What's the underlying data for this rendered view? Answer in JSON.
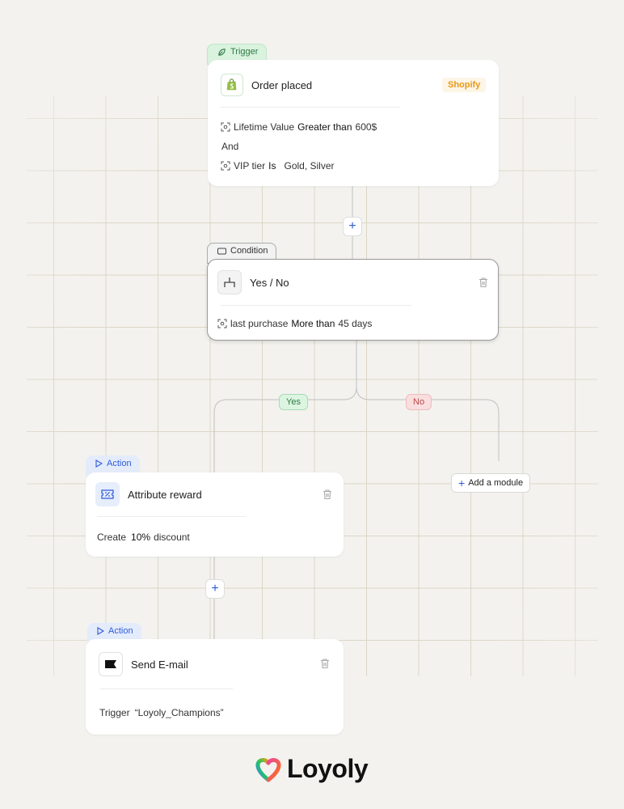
{
  "trigger": {
    "tag_label": "Trigger",
    "title": "Order placed",
    "badge": "Shopify",
    "rule1": {
      "field": "Lifetime Value",
      "operator": "Greater than",
      "value": "600$"
    },
    "joiner": "And",
    "rule2": {
      "field": "VIP tier",
      "operator": "Is",
      "value": "Gold, Silver"
    }
  },
  "condition": {
    "tag_label": "Condition",
    "title": "Yes / No",
    "rule": {
      "field": "last purchase",
      "operator": "More than",
      "value": "45 days"
    },
    "yes_label": "Yes",
    "no_label": "No"
  },
  "add_step": {
    "symbol": "+"
  },
  "add_module": {
    "label": "Add a module"
  },
  "action1": {
    "tag_label": "Action",
    "title": "Attribute reward",
    "desc": {
      "prefix": "Create",
      "value": "10%",
      "suffix": "discount"
    }
  },
  "action2": {
    "tag_label": "Action",
    "title": "Send E-mail",
    "desc": {
      "prefix": "Trigger",
      "value": "“Loyoly_Champions”"
    }
  },
  "brand": {
    "name": "Loyoly"
  },
  "colors": {
    "accent": "#2f5bd6",
    "shopify": "#e79a1a",
    "yes": "#2f7a44",
    "no": "#b94848"
  }
}
